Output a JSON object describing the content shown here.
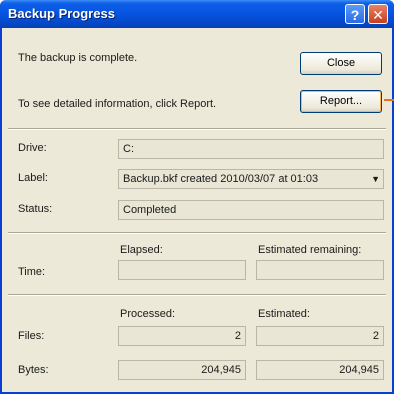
{
  "window": {
    "title": "Backup Progress"
  },
  "title_buttons": {
    "help": "?",
    "close": "✕"
  },
  "messages": {
    "complete": "The backup is complete.",
    "details": "To see detailed information, click Report."
  },
  "buttons": {
    "close": "Close",
    "report": "Report..."
  },
  "info": {
    "drive_label": "Drive:",
    "drive_value": "C:",
    "label_label": "Label:",
    "label_value": "Backup.bkf created 2010/03/07 at 01:03  ",
    "status_label": "Status:",
    "status_value": "Completed"
  },
  "time": {
    "row_label": "Time:",
    "elapsed_header": "Elapsed:",
    "elapsed_value": "",
    "remaining_header": "Estimated remaining:",
    "remaining_value": ""
  },
  "stats": {
    "processed_header": "Processed:",
    "estimated_header": "Estimated:",
    "files_label": "Files:",
    "files_processed": "2",
    "files_estimated": "2",
    "bytes_label": "Bytes:",
    "bytes_processed": "204,945",
    "bytes_estimated": "204,945"
  },
  "icons": {
    "dropdown": "chevron-down-icon",
    "help": "help-icon",
    "close": "close-icon"
  },
  "colors": {
    "titlebar": "#0653df",
    "window_bg": "#ece9d8",
    "close_btn": "#c8401c",
    "report_arrow": "#e8701f"
  }
}
